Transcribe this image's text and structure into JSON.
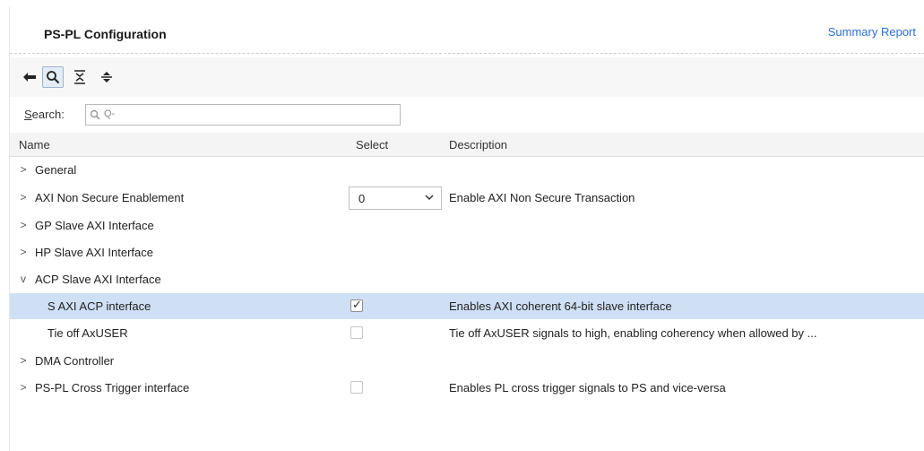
{
  "header": {
    "title": "PS-PL Configuration",
    "summary_link": "Summary Report"
  },
  "toolbar": {
    "icons": [
      "back-arrow-icon",
      "search-icon",
      "collapse-all-icon",
      "expand-all-icon"
    ]
  },
  "search": {
    "label_prefix": "",
    "label_underline": "S",
    "label_rest": "earch:",
    "placeholder": "Q-"
  },
  "table": {
    "columns": {
      "name": "Name",
      "select": "Select",
      "description": "Description"
    },
    "rows": [
      {
        "chevron": ">",
        "name": "General",
        "description": ""
      },
      {
        "chevron": ">",
        "name": "AXI Non Secure Enablement",
        "select_value": "0",
        "description": "Enable AXI Non Secure Transaction"
      },
      {
        "chevron": ">",
        "name": "GP Slave AXI Interface",
        "description": ""
      },
      {
        "chevron": ">",
        "name": "HP Slave AXI Interface",
        "description": ""
      },
      {
        "chevron": "v",
        "name": "ACP Slave AXI Interface",
        "description": ""
      },
      {
        "chevron": "",
        "name": "S AXI ACP interface",
        "checked": true,
        "description": "Enables AXI coherent 64-bit slave interface"
      },
      {
        "chevron": "",
        "name": "Tie off AxUSER",
        "checked": false,
        "description": "Tie off AxUSER signals to high, enabling coherency when allowed by ..."
      },
      {
        "chevron": ">",
        "name": "DMA Controller",
        "description": ""
      },
      {
        "chevron": ">",
        "name": "PS-PL Cross Trigger interface",
        "checked": false,
        "description": "Enables PL cross trigger signals to PS and vice-versa"
      }
    ]
  },
  "colors": {
    "accent": "#2a6fd1",
    "selected_row": "#cfe0f5"
  }
}
